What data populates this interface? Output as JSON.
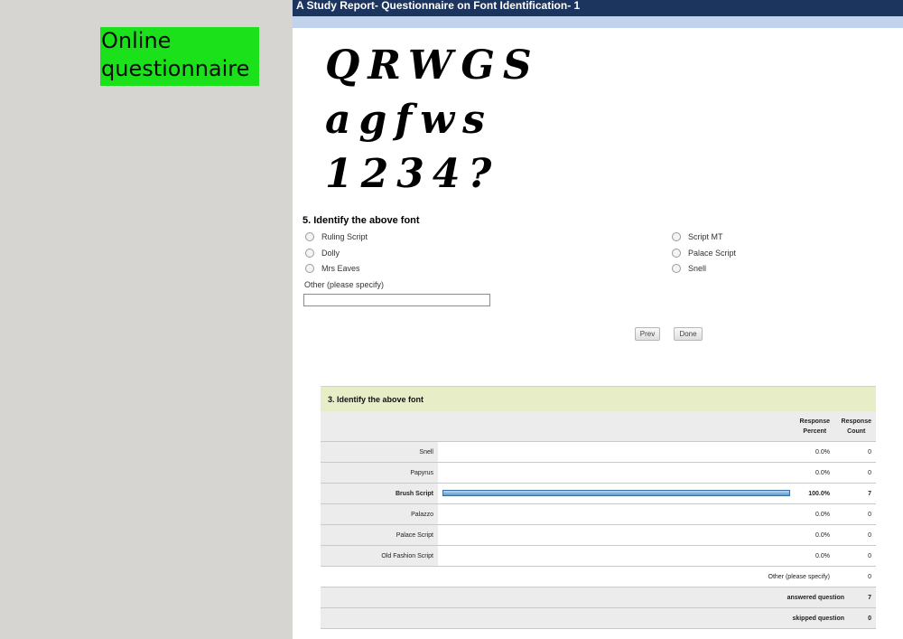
{
  "side_label": "Online questionnaire",
  "survey": {
    "header_title": "A Study Report- Questionnaire on Font Identification- 1",
    "specimen_lines": [
      "QRWGS",
      "agfws",
      "1234?"
    ],
    "question_title": "5. Identify the above font",
    "options_left": [
      "Ruling Script",
      "Dolly",
      "Mrs Eaves"
    ],
    "options_right": [
      "Script MT",
      "Palace Script",
      "Snell"
    ],
    "other_label": "Other (please specify)",
    "other_value": "",
    "prev_label": "Prev",
    "done_label": "Done"
  },
  "results": {
    "title": "3. Identify the above font",
    "col_percent_line1": "Response",
    "col_percent_line2": "Percent",
    "col_count_line1": "Response",
    "col_count_line2": "Count",
    "rows": [
      {
        "label": "Snell",
        "percent": "0.0%",
        "count": "0",
        "fraction": 0
      },
      {
        "label": "Papyrus",
        "percent": "0.0%",
        "count": "0",
        "fraction": 0
      },
      {
        "label": "Brush Script",
        "percent": "100.0%",
        "count": "7",
        "fraction": 1
      },
      {
        "label": "Palazzo",
        "percent": "0.0%",
        "count": "0",
        "fraction": 0
      },
      {
        "label": "Palace Script",
        "percent": "0.0%",
        "count": "0",
        "fraction": 0
      },
      {
        "label": "Old Fashion Script",
        "percent": "0.0%",
        "count": "0",
        "fraction": 0
      }
    ],
    "other_label": "Other (please specify)",
    "other_count": "0",
    "answered_label": "answered question",
    "answered_count": "7",
    "skipped_label": "skipped question",
    "skipped_count": "0"
  },
  "colors": {
    "label_bg": "#1be11b",
    "header_bg": "#1c355e",
    "results_title_bg": "#e7edc6",
    "bar_fill": "#8fbbe3"
  }
}
